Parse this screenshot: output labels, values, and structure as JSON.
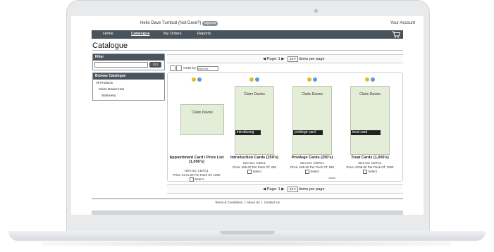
{
  "topbar": {
    "greeting": "Hello Dave Turnbull (Not Dave?)",
    "signout_label": "signout",
    "account_link": "Your Account"
  },
  "nav": {
    "items": [
      "Home",
      "Catalogue",
      "My Orders",
      "Reports"
    ],
    "active": "Catalogue"
  },
  "page": {
    "title": "Catalogue"
  },
  "filter": {
    "heading": "Filter",
    "go_label": "GO"
  },
  "browse": {
    "heading": "Browse Catalogue",
    "items": [
      "All Products",
      "Claire Davies Hair",
      "Stationery"
    ]
  },
  "pager": {
    "prefix": "Page:",
    "page": "1",
    "per_page": "10",
    "suffix": "items per page"
  },
  "order": {
    "label": "Order by:",
    "value": "Item No."
  },
  "products": [
    {
      "name": "Appointment Card / Price List (1,000's)",
      "item_no": "Item No: CDAC1",
      "price": "Price: £171.00 Per Pack Of: 1000",
      "select": "Select",
      "brand": "Claire Davies",
      "band": ""
    },
    {
      "name": "Introduction Cards (250's)",
      "item_no": "Item No: CDIC1",
      "price": "Price: £55.00 Per Pack Of: 250",
      "select": "Select",
      "brand": "Claire Davies",
      "band": "introducing"
    },
    {
      "name": "Privilege Cards (250's)",
      "item_no": "Item No: CDPC1",
      "price": "Price: £55.00 Per Pack Of: 250",
      "select": "Select",
      "brand": "Claire Davies",
      "band": "privilege card"
    },
    {
      "name": "Treat Cards (1,000's)",
      "item_no": "Item No: CDTC1",
      "price": "Price: £106.00 Per Pack Of: 1000",
      "select": "Select",
      "brand": "Claire Davies",
      "band": "treat card"
    }
  ],
  "footer": {
    "links": [
      "Terms & Conditions",
      "About Us",
      "Contact Us"
    ]
  }
}
